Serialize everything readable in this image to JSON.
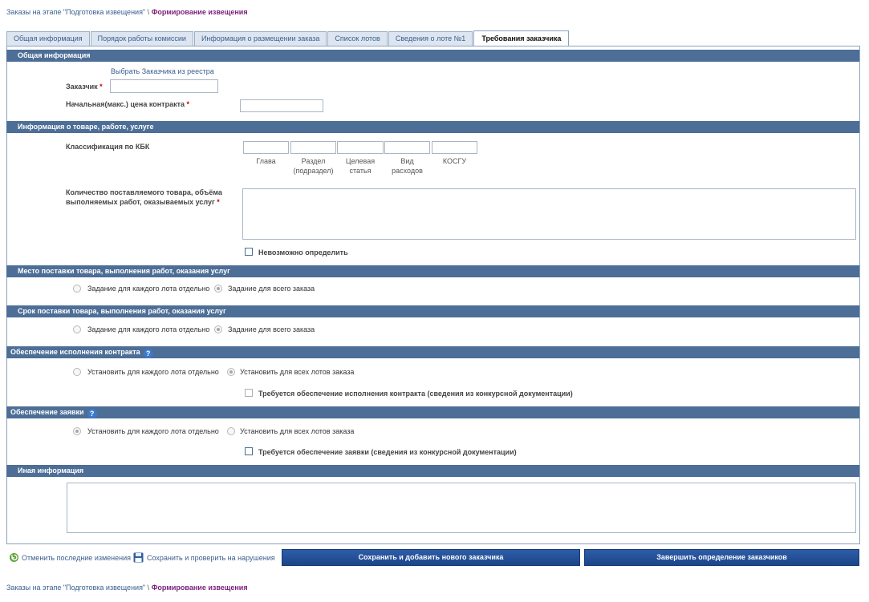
{
  "breadcrumb": {
    "link": "Заказы на этапе \"Подготовка извещения\"",
    "sep": "\\",
    "current": "Формирование извещения"
  },
  "tabs": [
    {
      "label": "Общая информация"
    },
    {
      "label": "Порядок работы комиссии"
    },
    {
      "label": "Информация о размещении заказа"
    },
    {
      "label": "Список лотов"
    },
    {
      "label": "Сведения о лоте №1"
    },
    {
      "label": "Требования заказчика"
    }
  ],
  "sections": {
    "general": "Общая информация",
    "goods": "Информация о товаре, работе, услуге",
    "place": "Место поставки товара, выполнения работ, оказания услуг",
    "term": "Срок поставки товара, выполнения работ, оказания услуг",
    "contract_security": "Обеспечение исполнения контракта",
    "bid_security": "Обеспечение заявки",
    "other": "Иная информация"
  },
  "general": {
    "select_link": "Выбрать Заказчика из реестра",
    "customer_label": "Заказчик",
    "price_label": "Начальная(макс.) цена контракта",
    "required_mark": "*"
  },
  "goods": {
    "kbk_label": "Классификация по КБК",
    "kbk_fields": [
      "Глава",
      "Раздел (подраздел)",
      "Целевая статья",
      "Вид расходов",
      "КОСГУ"
    ],
    "qty_label": "Количество поставляемого товара, объёма выполняемых работ, оказываемых услуг",
    "undefined_label": "Невозможно определить"
  },
  "radios": {
    "per_lot_task": "Задание для каждого лота отдельно",
    "whole_order_task": "Задание для всего заказа",
    "per_lot_set": "Установить для каждого лота отдельно",
    "all_lots_set": "Установить для всех лотов заказа"
  },
  "contract_security": {
    "check_label": "Требуется обеспечение исполнения контракта (сведения из конкурсной документации)"
  },
  "bid_security": {
    "check_label": "Требуется обеспечение заявки (сведения из конкурсной документации)"
  },
  "help_glyph": "?",
  "toolbar": {
    "undo_label": "Отменить последние изменения",
    "save_check_label": "Сохранить и проверить на нарушения",
    "save_add_label": "Сохранить и добавить нового заказчика",
    "finish_label": "Завершить определение заказчиков"
  },
  "colors": {
    "section_bar": "#4d6e96",
    "button": "#1f4b90",
    "link": "#3a5f8f",
    "breadcrumb_current": "#7a1f7a",
    "required": "#cc0000"
  }
}
